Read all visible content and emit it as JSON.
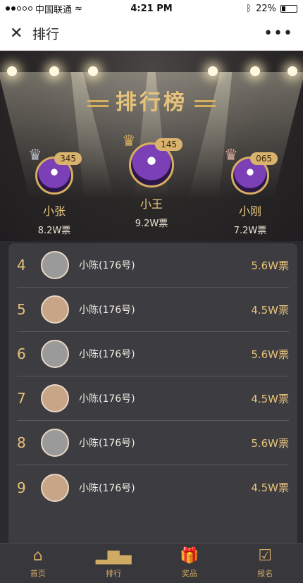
{
  "status_bar": {
    "carrier": "中国联通",
    "time": "4:21 PM",
    "battery": "22%"
  },
  "nav": {
    "close_icon": "close-icon",
    "title": "排行",
    "more_icon": "more-icon"
  },
  "hero": {
    "title": "排行榜"
  },
  "podium": [
    {
      "place": 2,
      "name": "小张",
      "votes": "8.2W票",
      "score": "345"
    },
    {
      "place": 1,
      "name": "小王",
      "votes": "9.2W票",
      "score": "145"
    },
    {
      "place": 3,
      "name": "小刚",
      "votes": "7.2W票",
      "score": "065"
    }
  ],
  "list": [
    {
      "rank": "4",
      "name": "小陈(176号)",
      "votes": "5.6W票"
    },
    {
      "rank": "5",
      "name": "小陈(176号)",
      "votes": "4.5W票"
    },
    {
      "rank": "6",
      "name": "小陈(176号)",
      "votes": "5.6W票"
    },
    {
      "rank": "7",
      "name": "小陈(176号)",
      "votes": "4.5W票"
    },
    {
      "rank": "8",
      "name": "小陈(176号)",
      "votes": "5.6W票"
    },
    {
      "rank": "9",
      "name": "小陈(176号)",
      "votes": "4.5W票"
    }
  ],
  "tabbar": [
    {
      "label": "首页",
      "icon": "home-icon"
    },
    {
      "label": "排行",
      "icon": "ranking-icon"
    },
    {
      "label": "奖品",
      "icon": "gift-icon"
    },
    {
      "label": "报名",
      "icon": "signup-icon"
    }
  ],
  "colors": {
    "gold": "#e7c27a",
    "background": "#2b2a2e"
  }
}
